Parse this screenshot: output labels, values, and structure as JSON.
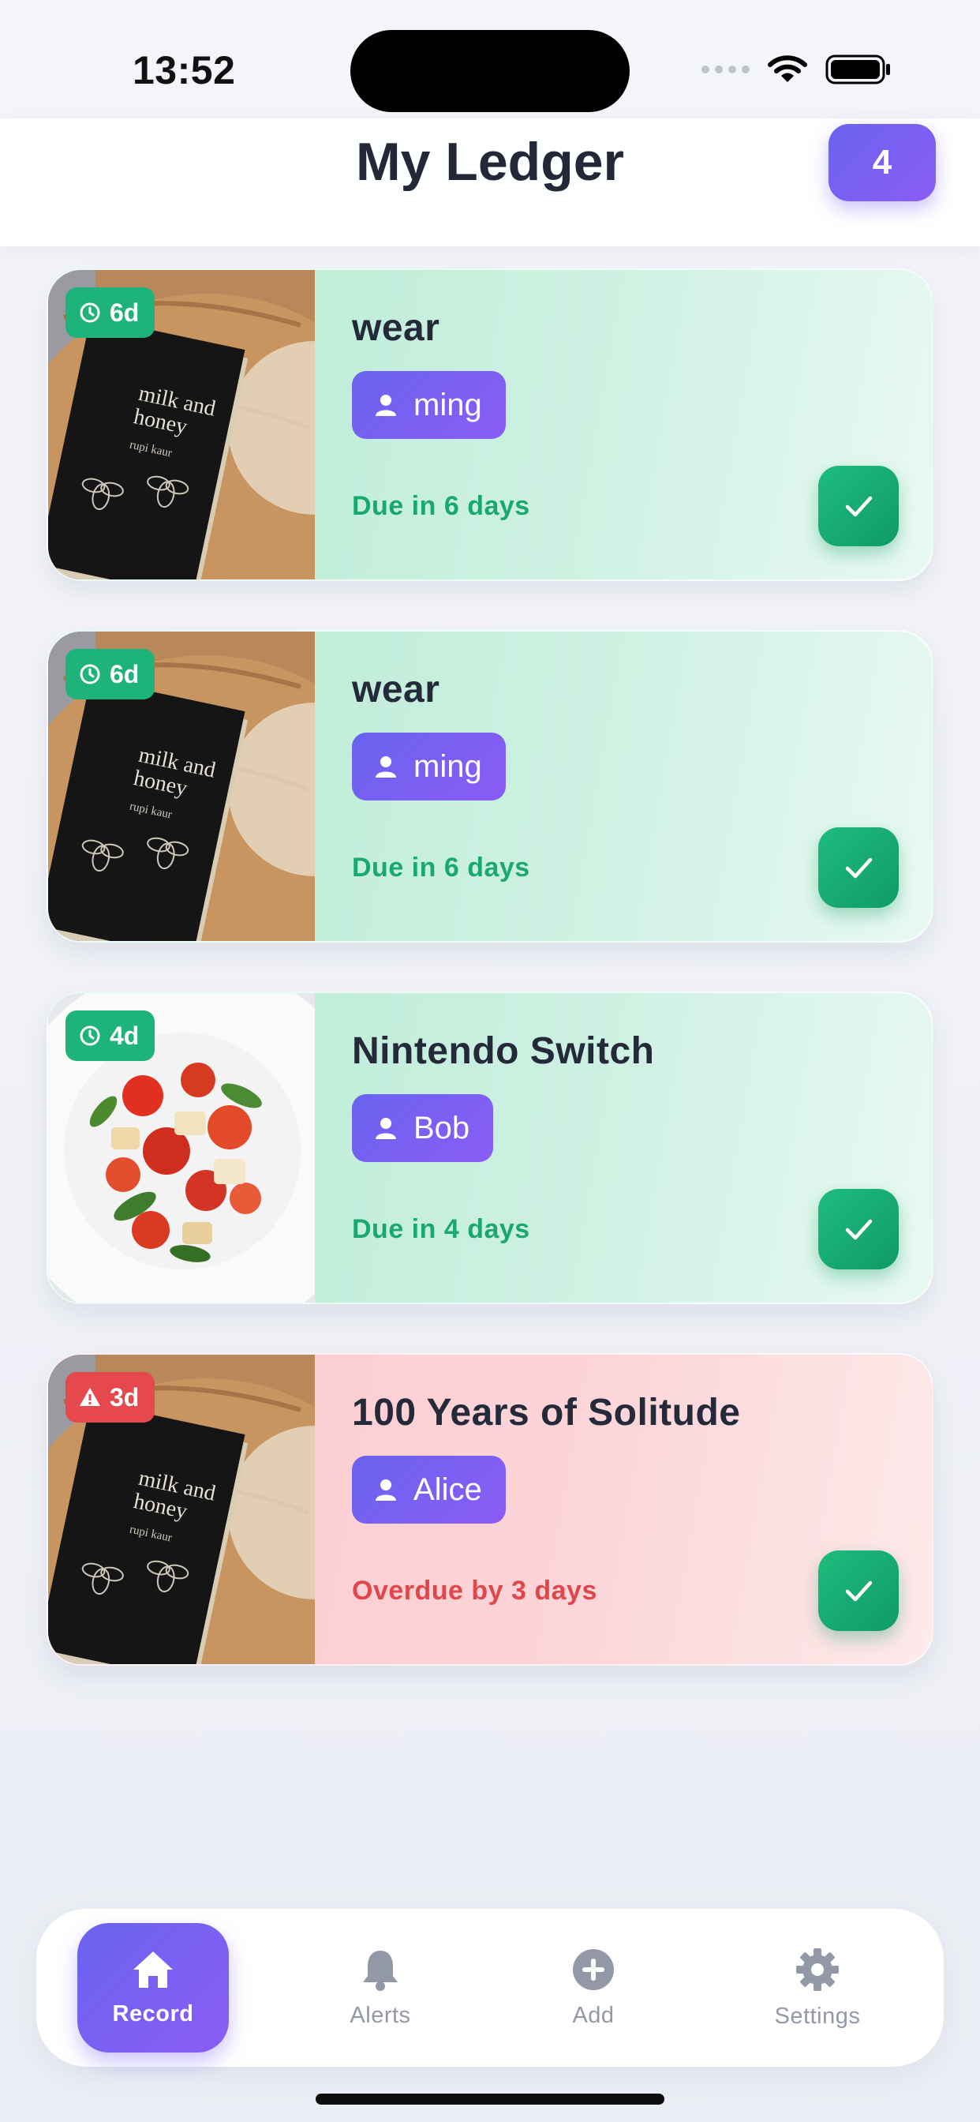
{
  "status_bar": {
    "time": "13:52"
  },
  "header": {
    "title": "My Ledger",
    "count": "4"
  },
  "colors": {
    "accent": "#6a63f0",
    "success": "#1fb37c",
    "danger": "#e5484d",
    "card_ok": "#c6efdd",
    "card_late": "#fbcfd3"
  },
  "cards": [
    {
      "days": "6d",
      "days_icon": "clock-icon",
      "name": "wear",
      "person": "ming",
      "due": "Due in 6 days",
      "status": "due",
      "thumb": "book-photo"
    },
    {
      "days": "6d",
      "days_icon": "clock-icon",
      "name": "wear",
      "person": "ming",
      "due": "Due in 6 days",
      "status": "due",
      "thumb": "book-photo"
    },
    {
      "days": "4d",
      "days_icon": "clock-icon",
      "name": "Nintendo Switch",
      "person": "Bob",
      "due": "Due in 4 days",
      "status": "due",
      "thumb": "salad-photo"
    },
    {
      "days": "3d",
      "days_icon": "warning-icon",
      "name": "100 Years of Solitude",
      "person": "Alice",
      "due": "Overdue by 3 days",
      "status": "overdue",
      "thumb": "book-photo"
    }
  ],
  "book_cover": {
    "title_line1": "milk and",
    "title_line2": "honey",
    "author": "rupi kaur"
  },
  "tabs": [
    {
      "label": "Record",
      "icon": "home-icon",
      "active": true
    },
    {
      "label": "Alerts",
      "icon": "bell-icon",
      "active": false
    },
    {
      "label": "Add",
      "icon": "plus-circle-icon",
      "active": false
    },
    {
      "label": "Settings",
      "icon": "gear-icon",
      "active": false
    }
  ]
}
